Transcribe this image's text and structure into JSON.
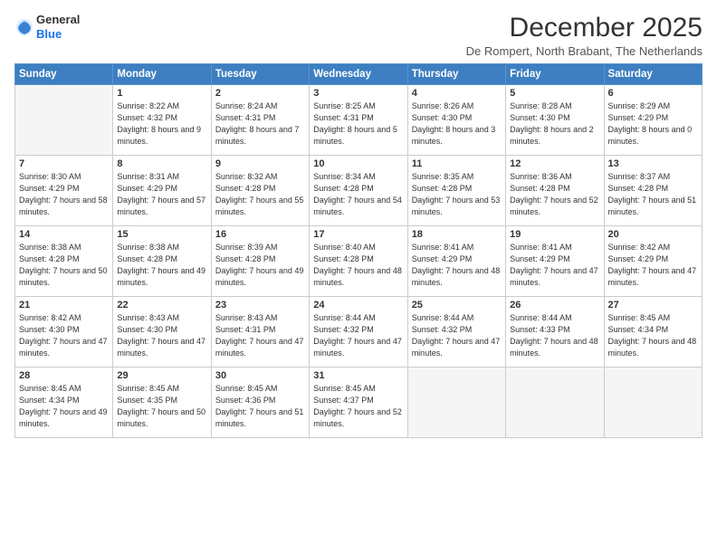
{
  "logo": {
    "general": "General",
    "blue": "Blue"
  },
  "title": "December 2025",
  "location": "De Rompert, North Brabant, The Netherlands",
  "headers": [
    "Sunday",
    "Monday",
    "Tuesday",
    "Wednesday",
    "Thursday",
    "Friday",
    "Saturday"
  ],
  "weeks": [
    [
      {
        "day": "",
        "empty": true
      },
      {
        "day": "1",
        "sunrise": "8:22 AM",
        "sunset": "4:32 PM",
        "daylight": "8 hours and 9 minutes."
      },
      {
        "day": "2",
        "sunrise": "8:24 AM",
        "sunset": "4:31 PM",
        "daylight": "8 hours and 7 minutes."
      },
      {
        "day": "3",
        "sunrise": "8:25 AM",
        "sunset": "4:31 PM",
        "daylight": "8 hours and 5 minutes."
      },
      {
        "day": "4",
        "sunrise": "8:26 AM",
        "sunset": "4:30 PM",
        "daylight": "8 hours and 3 minutes."
      },
      {
        "day": "5",
        "sunrise": "8:28 AM",
        "sunset": "4:30 PM",
        "daylight": "8 hours and 2 minutes."
      },
      {
        "day": "6",
        "sunrise": "8:29 AM",
        "sunset": "4:29 PM",
        "daylight": "8 hours and 0 minutes."
      }
    ],
    [
      {
        "day": "7",
        "sunrise": "8:30 AM",
        "sunset": "4:29 PM",
        "daylight": "7 hours and 58 minutes."
      },
      {
        "day": "8",
        "sunrise": "8:31 AM",
        "sunset": "4:29 PM",
        "daylight": "7 hours and 57 minutes."
      },
      {
        "day": "9",
        "sunrise": "8:32 AM",
        "sunset": "4:28 PM",
        "daylight": "7 hours and 55 minutes."
      },
      {
        "day": "10",
        "sunrise": "8:34 AM",
        "sunset": "4:28 PM",
        "daylight": "7 hours and 54 minutes."
      },
      {
        "day": "11",
        "sunrise": "8:35 AM",
        "sunset": "4:28 PM",
        "daylight": "7 hours and 53 minutes."
      },
      {
        "day": "12",
        "sunrise": "8:36 AM",
        "sunset": "4:28 PM",
        "daylight": "7 hours and 52 minutes."
      },
      {
        "day": "13",
        "sunrise": "8:37 AM",
        "sunset": "4:28 PM",
        "daylight": "7 hours and 51 minutes."
      }
    ],
    [
      {
        "day": "14",
        "sunrise": "8:38 AM",
        "sunset": "4:28 PM",
        "daylight": "7 hours and 50 minutes."
      },
      {
        "day": "15",
        "sunrise": "8:38 AM",
        "sunset": "4:28 PM",
        "daylight": "7 hours and 49 minutes."
      },
      {
        "day": "16",
        "sunrise": "8:39 AM",
        "sunset": "4:28 PM",
        "daylight": "7 hours and 49 minutes."
      },
      {
        "day": "17",
        "sunrise": "8:40 AM",
        "sunset": "4:28 PM",
        "daylight": "7 hours and 48 minutes."
      },
      {
        "day": "18",
        "sunrise": "8:41 AM",
        "sunset": "4:29 PM",
        "daylight": "7 hours and 48 minutes."
      },
      {
        "day": "19",
        "sunrise": "8:41 AM",
        "sunset": "4:29 PM",
        "daylight": "7 hours and 47 minutes."
      },
      {
        "day": "20",
        "sunrise": "8:42 AM",
        "sunset": "4:29 PM",
        "daylight": "7 hours and 47 minutes."
      }
    ],
    [
      {
        "day": "21",
        "sunrise": "8:42 AM",
        "sunset": "4:30 PM",
        "daylight": "7 hours and 47 minutes."
      },
      {
        "day": "22",
        "sunrise": "8:43 AM",
        "sunset": "4:30 PM",
        "daylight": "7 hours and 47 minutes."
      },
      {
        "day": "23",
        "sunrise": "8:43 AM",
        "sunset": "4:31 PM",
        "daylight": "7 hours and 47 minutes."
      },
      {
        "day": "24",
        "sunrise": "8:44 AM",
        "sunset": "4:32 PM",
        "daylight": "7 hours and 47 minutes."
      },
      {
        "day": "25",
        "sunrise": "8:44 AM",
        "sunset": "4:32 PM",
        "daylight": "7 hours and 47 minutes."
      },
      {
        "day": "26",
        "sunrise": "8:44 AM",
        "sunset": "4:33 PM",
        "daylight": "7 hours and 48 minutes."
      },
      {
        "day": "27",
        "sunrise": "8:45 AM",
        "sunset": "4:34 PM",
        "daylight": "7 hours and 48 minutes."
      }
    ],
    [
      {
        "day": "28",
        "sunrise": "8:45 AM",
        "sunset": "4:34 PM",
        "daylight": "7 hours and 49 minutes."
      },
      {
        "day": "29",
        "sunrise": "8:45 AM",
        "sunset": "4:35 PM",
        "daylight": "7 hours and 50 minutes."
      },
      {
        "day": "30",
        "sunrise": "8:45 AM",
        "sunset": "4:36 PM",
        "daylight": "7 hours and 51 minutes."
      },
      {
        "day": "31",
        "sunrise": "8:45 AM",
        "sunset": "4:37 PM",
        "daylight": "7 hours and 52 minutes."
      },
      {
        "day": "",
        "empty": true
      },
      {
        "day": "",
        "empty": true
      },
      {
        "day": "",
        "empty": true
      }
    ]
  ],
  "labels": {
    "sunrise": "Sunrise: ",
    "sunset": "Sunset: ",
    "daylight": "Daylight: "
  }
}
